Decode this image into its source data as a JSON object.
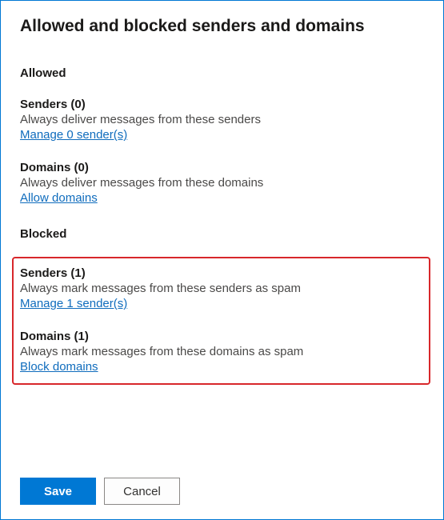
{
  "title": "Allowed and blocked senders and domains",
  "allowed": {
    "heading": "Allowed",
    "senders": {
      "title": "Senders (0)",
      "description": "Always deliver messages from these senders",
      "link": "Manage 0 sender(s)"
    },
    "domains": {
      "title": "Domains (0)",
      "description": "Always deliver messages from these domains",
      "link": "Allow domains"
    }
  },
  "blocked": {
    "heading": "Blocked",
    "senders": {
      "title": "Senders (1)",
      "description": "Always mark messages from these senders as spam",
      "link": "Manage 1 sender(s)"
    },
    "domains": {
      "title": "Domains (1)",
      "description": "Always mark messages from these domains as spam",
      "link": "Block domains"
    }
  },
  "buttons": {
    "save": "Save",
    "cancel": "Cancel"
  }
}
